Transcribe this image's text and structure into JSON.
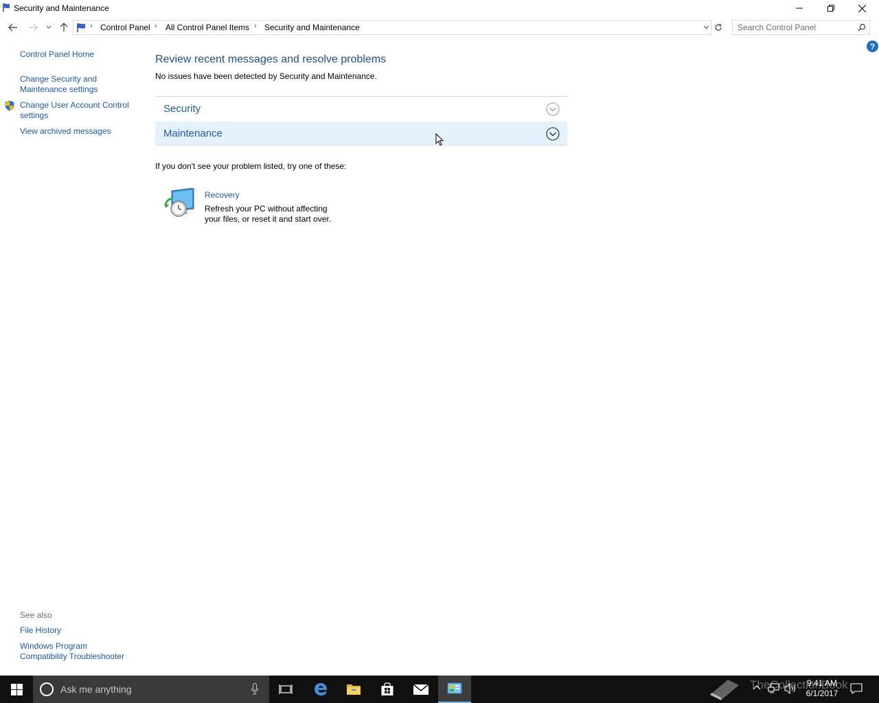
{
  "window": {
    "title": "Security and Maintenance"
  },
  "address": {
    "crumbs": [
      "Control Panel",
      "All Control Panel Items",
      "Security and Maintenance"
    ],
    "search_placeholder": "Search Control Panel"
  },
  "left_pane": {
    "home": "Control Panel Home",
    "links": [
      "Change Security and Maintenance settings",
      "Change User Account Control settings",
      "View archived messages"
    ],
    "see_also_title": "See also",
    "see_also": [
      "File History",
      "Windows Program Compatibility Troubleshooter"
    ]
  },
  "main": {
    "heading": "Review recent messages and resolve problems",
    "subtext": "No issues have been detected by Security and Maintenance.",
    "sections": [
      "Security",
      "Maintenance"
    ],
    "try_text": "If you don't see your problem listed, try one of these:",
    "recovery": {
      "title": "Recovery",
      "description": "Refresh your PC without affecting your files, or reset it and start over."
    }
  },
  "taskbar": {
    "search_placeholder": "Ask me anything",
    "watermark": "TheCollectionBook",
    "time": "9:41 AM",
    "date": "6/1/2017"
  },
  "colors": {
    "link": "#1b59a8",
    "heading": "#1e4e8c",
    "section_hover": "#e5f1fb",
    "taskbar": "#101010"
  }
}
